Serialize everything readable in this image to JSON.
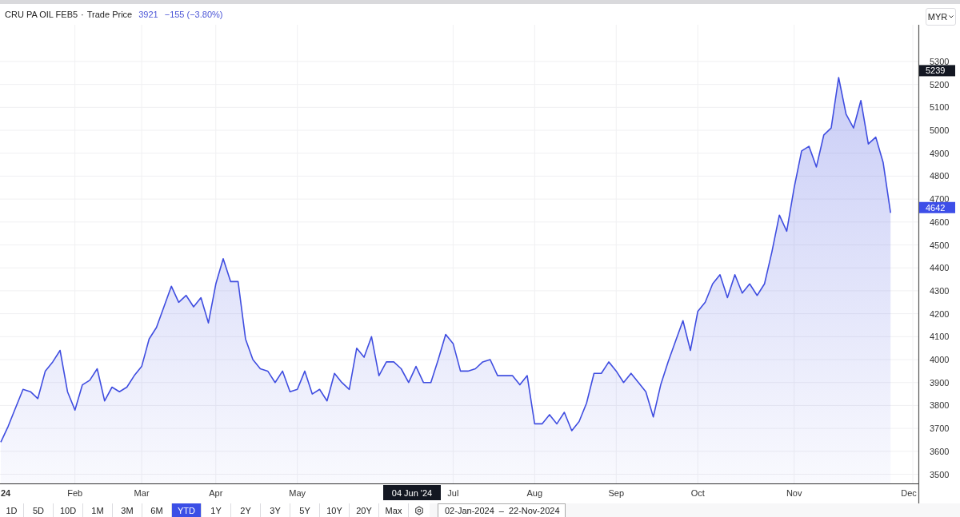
{
  "header": {
    "symbol": "CRU PA OIL FEB5",
    "separator": "·",
    "field": "Trade Price",
    "last": "3921",
    "change": "−155 (−3.80%)"
  },
  "currency": {
    "label": "MYR"
  },
  "chart": {
    "chart_data": {
      "type": "area",
      "categories": [
        "24",
        null,
        null,
        null,
        null,
        null,
        null,
        null,
        null,
        null,
        "Feb",
        null,
        null,
        null,
        null,
        null,
        null,
        null,
        null,
        "Mar",
        null,
        null,
        null,
        null,
        null,
        null,
        null,
        null,
        null,
        "Apr",
        null,
        null,
        null,
        null,
        null,
        null,
        null,
        null,
        null,
        null,
        "May",
        null,
        null,
        null,
        null,
        null,
        null,
        null,
        null,
        null,
        null,
        null,
        null,
        null,
        null,
        null,
        null,
        null,
        null,
        null,
        null,
        "Jul",
        null,
        null,
        null,
        null,
        null,
        null,
        null,
        null,
        null,
        null,
        "Aug",
        null,
        null,
        null,
        null,
        null,
        null,
        null,
        null,
        null,
        null,
        "Sep",
        null,
        null,
        null,
        null,
        null,
        null,
        null,
        null,
        null,
        null,
        "Oct",
        null,
        null,
        null,
        null,
        null,
        null,
        null,
        null,
        null,
        null,
        null,
        null,
        "Nov",
        null,
        null,
        null,
        null,
        null,
        null,
        null,
        null,
        null,
        null,
        null,
        null,
        null,
        null,
        null,
        "Dec"
      ],
      "series": [
        {
          "color": "#3f4de0",
          "values": [
            3640,
            3710,
            3790,
            3870,
            3860,
            3830,
            3950,
            3990,
            4040,
            3860,
            3780,
            3890,
            3910,
            3960,
            3820,
            3880,
            3860,
            3880,
            3930,
            3970,
            4090,
            4140,
            4230,
            4320,
            4250,
            4280,
            4230,
            4270,
            4160,
            4330,
            4440,
            4340,
            4340,
            4090,
            4000,
            3960,
            3950,
            3900,
            3950,
            3860,
            3870,
            3950,
            3850,
            3870,
            3820,
            3940,
            3900,
            3870,
            4050,
            4010,
            4100,
            3930,
            3990,
            3990,
            3960,
            3900,
            3970,
            3900,
            3900,
            4000,
            4110,
            4070,
            3950,
            3950,
            3960,
            3990,
            4000,
            3930,
            3930,
            3930,
            3890,
            3930,
            3720,
            3720,
            3760,
            3720,
            3770,
            3690,
            3730,
            3810,
            3940,
            3940,
            3990,
            3950,
            3900,
            3940,
            3900,
            3860,
            3750,
            3890,
            3990,
            4080,
            4170,
            4040,
            4210,
            4250,
            4330,
            4370,
            4270,
            4370,
            4290,
            4330,
            4280,
            4330,
            4470,
            4630,
            4560,
            4750,
            4910,
            4930,
            4840,
            4980,
            5010,
            5230,
            5070,
            5010,
            5130,
            4940,
            4970,
            4860,
            4640,
            null,
            null,
            null
          ]
        }
      ],
      "ylim": [
        3460,
        5460
      ],
      "grid": true,
      "yticks": [
        3500,
        3600,
        3700,
        3800,
        3900,
        4000,
        4100,
        4200,
        4300,
        4400,
        4500,
        4600,
        4700,
        4800,
        4900,
        5000,
        5100,
        5200,
        5300
      ],
      "annotations": [
        "04 Jun '24"
      ]
    },
    "price_tags": [
      {
        "label": "5239",
        "kind": "high"
      },
      {
        "label": "4642",
        "kind": "last"
      }
    ]
  },
  "ranges": [
    {
      "label": "1D",
      "selected": false
    },
    {
      "label": "5D",
      "selected": false
    },
    {
      "label": "10D",
      "selected": false
    },
    {
      "label": "1M",
      "selected": false
    },
    {
      "label": "3M",
      "selected": false
    },
    {
      "label": "6M",
      "selected": false
    },
    {
      "label": "YTD",
      "selected": true
    },
    {
      "label": "1Y",
      "selected": false
    },
    {
      "label": "2Y",
      "selected": false
    },
    {
      "label": "3Y",
      "selected": false
    },
    {
      "label": "5Y",
      "selected": false
    },
    {
      "label": "10Y",
      "selected": false
    },
    {
      "label": "20Y",
      "selected": false
    },
    {
      "label": "Max",
      "selected": false
    }
  ],
  "date_range": {
    "from": "02-Jan-2024",
    "separator": "–",
    "to": "22-Nov-2024"
  }
}
